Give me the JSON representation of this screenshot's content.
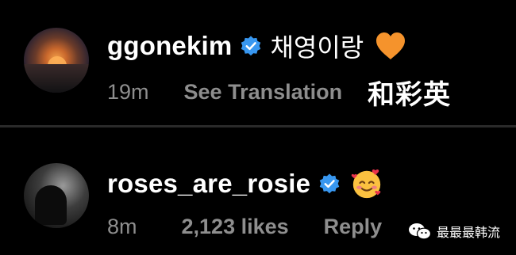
{
  "comments": [
    {
      "username": "ggonekim",
      "text": "채영이랑",
      "time": "19m",
      "action": "See Translation",
      "verified": true,
      "emoji_icon": "orange-heart-icon",
      "avatar_icon": "sunset-avatar"
    },
    {
      "username": "roses_are_rosie",
      "time": "8m",
      "likes": "2,123 likes",
      "action": "Reply",
      "verified": true,
      "emoji_icon": "smiling-face-with-hearts-icon",
      "avatar_icon": "dark-portrait-avatar"
    }
  ],
  "overlay_caption": "和彩英",
  "watermark": {
    "text": "最最最韩流",
    "icon": "wechat-icon"
  },
  "colors": {
    "background": "#000000",
    "username": "#ffffff",
    "meta": "#8e8e8e",
    "verified": "#3897f0",
    "divider": "#2a2a2a"
  }
}
